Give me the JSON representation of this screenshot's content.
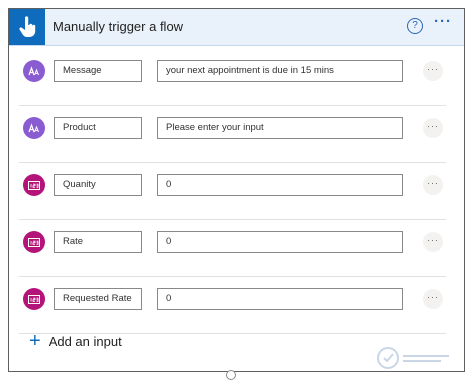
{
  "header": {
    "title": "Manually trigger a flow",
    "help_glyph": "?",
    "more_glyph": "···"
  },
  "inputs": [
    {
      "type": "text",
      "name": "Message",
      "value": "your next appointment is due in 15 mins"
    },
    {
      "type": "text",
      "name": "Product",
      "value": "Please enter your input"
    },
    {
      "type": "number",
      "name": "Quanity",
      "value": "0"
    },
    {
      "type": "number",
      "name": "Rate",
      "value": "0"
    },
    {
      "type": "number",
      "name": "Requested Rate",
      "value": "0"
    }
  ],
  "row_more_glyph": "···",
  "add_input": {
    "plus": "+",
    "label": "Add an input"
  },
  "colors": {
    "accent": "#0f6cbd",
    "text_avatar": "#8a5cd1",
    "number_avatar": "#b4147a",
    "header_bg": "#e9f1fb"
  },
  "icons": {
    "trigger": "hand-pointer-icon",
    "help": "question-circle-icon",
    "more": "ellipsis-icon",
    "text_type": "text-type-icon",
    "number_type": "number-type-icon",
    "add": "plus-icon"
  }
}
